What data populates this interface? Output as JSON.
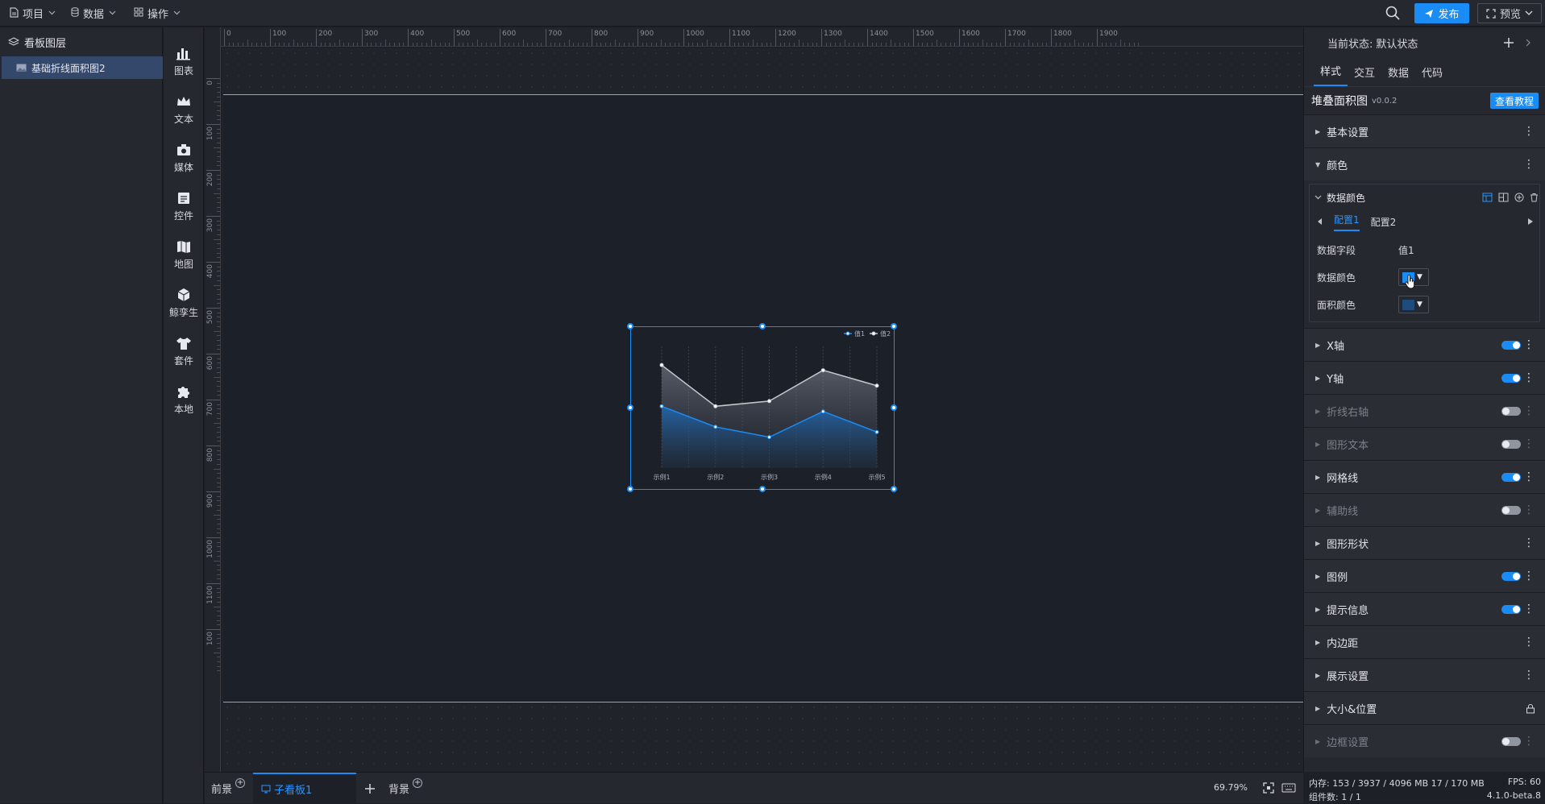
{
  "topbar": {
    "menus": [
      {
        "label": "项目",
        "icon": "file-icon"
      },
      {
        "label": "数据",
        "icon": "database-icon"
      },
      {
        "label": "操作",
        "icon": "grid-icon"
      }
    ],
    "publish_label": "发布",
    "preview_label": "预览"
  },
  "layers": {
    "title": "看板图层",
    "items": [
      {
        "label": "基础折线面积图2"
      }
    ]
  },
  "toolbox": {
    "items": [
      {
        "label": "图表",
        "icon": "bar-chart-icon"
      },
      {
        "label": "文本",
        "icon": "crown-icon"
      },
      {
        "label": "媒体",
        "icon": "camera-icon"
      },
      {
        "label": "控件",
        "icon": "widget-icon"
      },
      {
        "label": "地图",
        "icon": "map-icon"
      },
      {
        "label": "鲸孪生",
        "icon": "cube-icon"
      },
      {
        "label": "套件",
        "icon": "shirt-icon"
      },
      {
        "label": "本地",
        "icon": "puzzle-icon"
      }
    ]
  },
  "ruler": {
    "top_ticks": [
      "0",
      "100",
      "200",
      "300",
      "400",
      "500",
      "600",
      "700",
      "800",
      "900",
      "1000",
      "1100",
      "1200",
      "1300",
      "1400",
      "1500",
      "1600",
      "1700",
      "1800",
      "1900"
    ],
    "left_ticks": [
      "0",
      "100",
      "200",
      "300",
      "400",
      "500",
      "600",
      "700",
      "800",
      "900",
      "1000",
      "1100",
      "100"
    ]
  },
  "widget_chart": {
    "chart_data": {
      "type": "area",
      "categories": [
        "示例1",
        "示例2",
        "示例3",
        "示例4",
        "示例5"
      ],
      "series": [
        {
          "name": "值1",
          "values": [
            60,
            40,
            30,
            55,
            35
          ],
          "color": "#1a8cf5"
        },
        {
          "name": "值2",
          "values": [
            100,
            60,
            65,
            95,
            80
          ],
          "color": "#c4c8d0"
        }
      ],
      "ylim": [
        0,
        115
      ],
      "legend": "top-right",
      "grid": true
    }
  },
  "bottombar": {
    "tabs": [
      {
        "label": "前景"
      },
      {
        "label": "子看板1"
      },
      {
        "label": "背景"
      }
    ],
    "zoom": "69.79%"
  },
  "right_panel": {
    "state_label": "当前状态:",
    "state_value": "默认状态",
    "tabs": [
      "样式",
      "交互",
      "数据",
      "代码"
    ],
    "component_name": "堆叠面积图",
    "component_version": "v0.0.2",
    "tutorial_label": "查看教程",
    "sections_top": [
      {
        "label": "基本设置",
        "expanded": false
      },
      {
        "label": "颜色",
        "expanded": true
      }
    ],
    "color_box": {
      "title": "数据颜色",
      "tabs": [
        "配置1",
        "配置2"
      ],
      "field_label": "数据字段",
      "field_value": "值1",
      "data_color_label": "数据颜色",
      "data_color": "#1a8cf5",
      "area_color_label": "面积颜色",
      "area_color": "#1f4c7c"
    },
    "sections": [
      {
        "label": "X轴",
        "toggle": "on"
      },
      {
        "label": "Y轴",
        "toggle": "on"
      },
      {
        "label": "折线右轴",
        "toggle": "off"
      },
      {
        "label": "图形文本",
        "toggle": "off"
      },
      {
        "label": "网格线",
        "toggle": "on"
      },
      {
        "label": "辅助线",
        "toggle": "off"
      },
      {
        "label": "图形形状",
        "toggle": "none"
      },
      {
        "label": "图例",
        "toggle": "on"
      },
      {
        "label": "提示信息",
        "toggle": "on"
      },
      {
        "label": "内边距",
        "toggle": "none"
      },
      {
        "label": "展示设置",
        "toggle": "none"
      },
      {
        "label": "大小&位置",
        "toggle": "lock"
      },
      {
        "label": "边框设置",
        "toggle": "off"
      }
    ]
  },
  "status": {
    "memory": "内存: 153 / 3937 / 4096 MB 17 / 170 MB",
    "fps": "FPS: 60",
    "components": "组件数: 1 / 1",
    "version": "4.1.0-beta.8"
  }
}
